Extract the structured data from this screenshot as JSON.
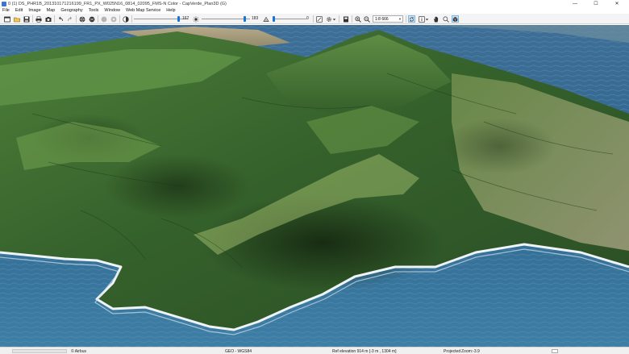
{
  "window": {
    "title": "0 (1) DS_PHR1B_201310171216199_FR1_PX_W025N16_0814_02095_FMS-N Color - CapVerde_Plan3D (G)",
    "controls": {
      "minimize": "—",
      "maximize": "☐",
      "close": "✕"
    }
  },
  "menu": [
    "File",
    "Edit",
    "Image",
    "Map",
    "Geography",
    "Tools",
    "Window",
    "Web Map Service",
    "Help"
  ],
  "toolbar": {
    "slider1_value": "167",
    "slider1_fraction": 0.83,
    "slider2_value": "183",
    "slider2_fraction": 0.92,
    "slider3_value": "0",
    "slider3_fraction": 0.0,
    "scale": "1:8 666",
    "icons": [
      "new-icon",
      "open-icon",
      "save-icon",
      "print-icon",
      "camera-icon",
      "undo-icon",
      "redo-icon",
      "globe-icon",
      "globe2-icon",
      "sphere-icon",
      "sphere2-icon",
      "contrast-icon",
      "sun-icon",
      "light-icon",
      "tilt-icon",
      "layout-icon",
      "settings-icon",
      "page-icon",
      "zoom-in-icon",
      "zoom-out-icon",
      "sync-icon",
      "info-icon",
      "hand-icon",
      "search-icon",
      "cube-icon"
    ],
    "colors": {
      "accent": "#1a73d9"
    }
  },
  "status": {
    "copyright": "© Airbus",
    "crs": "GEO - WGS84",
    "elevation": "Ref elevation 914 m [-3 m , 1304 m]",
    "projection": "Projected",
    "zoom": "Zoom:-3.9"
  }
}
